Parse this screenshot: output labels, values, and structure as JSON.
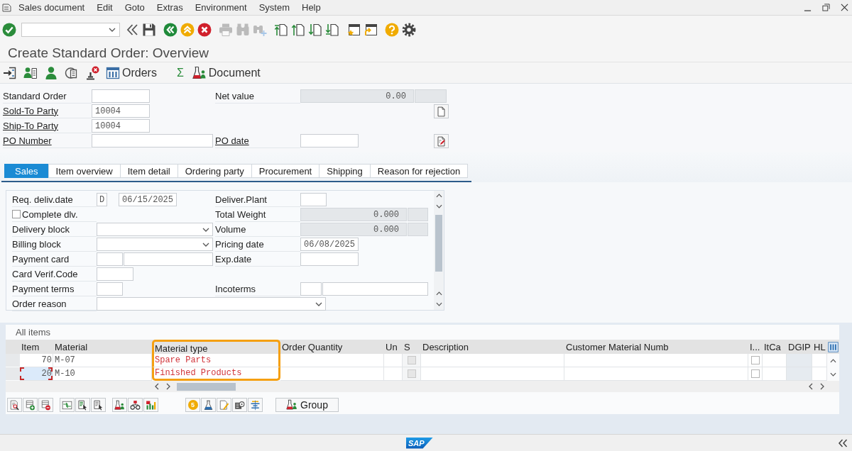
{
  "menu_bar": {
    "items": [
      "Sales document",
      "Edit",
      "Goto",
      "Extras",
      "Environment",
      "System",
      "Help"
    ]
  },
  "toolbar": {
    "groups": [
      [
        {
          "kind": "enter",
          "disabled": false
        },
        {
          "kind": "command-field",
          "disabled": false
        },
        {
          "kind": "collapse",
          "disabled": false
        },
        {
          "kind": "save",
          "disabled": false
        }
      ],
      [
        {
          "kind": "back",
          "disabled": false
        },
        {
          "kind": "exit",
          "disabled": false
        },
        {
          "kind": "cancel",
          "disabled": false
        }
      ],
      [
        {
          "kind": "print",
          "disabled": true
        },
        {
          "kind": "find",
          "disabled": true
        },
        {
          "kind": "find-next",
          "disabled": true
        }
      ],
      [
        {
          "kind": "first-page",
          "disabled": false
        },
        {
          "kind": "previous-page",
          "disabled": false
        },
        {
          "kind": "next-page",
          "disabled": false
        },
        {
          "kind": "last-page",
          "disabled": false
        }
      ],
      [
        {
          "kind": "new-session",
          "disabled": false
        },
        {
          "kind": "shortcut",
          "disabled": false
        }
      ],
      [
        {
          "kind": "help",
          "disabled": false
        },
        {
          "kind": "settings",
          "disabled": false
        }
      ]
    ]
  },
  "title": "Create Standard Order: Overview",
  "app_toolbar": {
    "items": [
      {
        "kind": "arrow-into-page"
      },
      {
        "kind": "person-page"
      },
      {
        "kind": "person"
      },
      {
        "kind": "display"
      },
      {
        "kind": "stamp-delete"
      },
      {
        "kind": "table",
        "label": "Orders"
      },
      {
        "kind": "sum",
        "label": "Σ"
      },
      {
        "kind": "flask",
        "label": "Document"
      }
    ]
  },
  "header": {
    "rows": [
      {
        "left": {
          "label": "Standard Order",
          "link": false,
          "kind": "short"
        },
        "right": {
          "label": "Net value",
          "link": false,
          "kind": "amount",
          "value": "0.00"
        }
      },
      {
        "left": {
          "label": "Sold-To Party",
          "link": true,
          "kind": "short",
          "value": "10004"
        },
        "button": {
          "kind": "page"
        }
      },
      {
        "left": {
          "label": "Ship-To Party",
          "link": true,
          "kind": "short",
          "value": "10004"
        }
      },
      {
        "left": {
          "label": "PO Number",
          "link": true,
          "kind": "long"
        },
        "right": {
          "label": "PO date",
          "link": true,
          "kind": "short"
        },
        "button": {
          "kind": "page-pen"
        }
      }
    ]
  },
  "tabs": [
    {
      "label": "Sales",
      "selected": true
    },
    {
      "label": "Item overview",
      "selected": false
    },
    {
      "label": "Item detail",
      "selected": false
    },
    {
      "label": "Ordering party",
      "selected": false
    },
    {
      "label": "Procurement",
      "selected": false
    },
    {
      "label": "Shipping",
      "selected": false
    },
    {
      "label": "Reason for rejection",
      "selected": false
    }
  ],
  "sales_tab": {
    "rows": [
      {
        "left": {
          "label": "Req. deliv.date",
          "link": false,
          "kind": "code-date",
          "code": "D",
          "value": "06/15/2025"
        },
        "right": {
          "label": "Deliver.Plant",
          "link": false,
          "kind": "tiny"
        }
      },
      {
        "left": {
          "label": "Complete dlv.",
          "link": false,
          "kind": "checkbox",
          "checked": false
        },
        "right": {
          "label": "Total Weight",
          "link": false,
          "kind": "amount",
          "value": "0.000"
        }
      },
      {
        "left": {
          "label": "Delivery block",
          "link": false,
          "kind": "dropdown"
        },
        "right": {
          "label": "Volume",
          "link": false,
          "kind": "amount",
          "value": "0.000"
        }
      },
      {
        "left": {
          "label": "Billing block",
          "link": false,
          "kind": "dropdown"
        },
        "right": {
          "label": "Pricing date",
          "link": false,
          "kind": "short",
          "value": "06/08/2025"
        }
      },
      {
        "left": {
          "label": "Payment card",
          "link": false,
          "kind": "pair"
        },
        "right": {
          "label": "Exp.date",
          "link": false,
          "kind": "short"
        }
      },
      {
        "left": {
          "label": "Card Verif.Code",
          "link": false,
          "kind": "small"
        }
      },
      {
        "left": {
          "label": "Payment terms",
          "link": false,
          "kind": "tiny"
        },
        "right": {
          "label": "Incoterms",
          "link": false,
          "kind": "pair"
        }
      },
      {
        "left": {
          "label": "Order reason",
          "link": false,
          "kind": "wide-dropdown"
        }
      }
    ]
  },
  "items_table": {
    "title": "All items",
    "columns": [
      {
        "label": "Item",
        "highlighted": false
      },
      {
        "label": "Material",
        "highlighted": false
      },
      {
        "label": "Material type",
        "highlighted": true
      },
      {
        "label": "Order Quantity",
        "highlighted": false
      },
      {
        "label": "Un",
        "highlighted": false
      },
      {
        "label": "S",
        "highlighted": false
      },
      {
        "label": "Description",
        "highlighted": false
      },
      {
        "label": "Customer Material Numb",
        "highlighted": false
      },
      {
        "label": "I...",
        "highlighted": false
      },
      {
        "label": "ItCa",
        "highlighted": false
      },
      {
        "label": "DGIP",
        "highlighted": false
      },
      {
        "label": "HL",
        "highlighted": false
      }
    ],
    "rows": [
      {
        "item": "70",
        "material": "M-07",
        "material_type": "Spare Parts",
        "s_checked": false,
        "i_checked": false,
        "focused": false
      },
      {
        "item": "20",
        "material": "M-10",
        "material_type": "Finished Products",
        "s_checked": false,
        "i_checked": false,
        "focused": true
      }
    ]
  },
  "items_toolbar": {
    "groups": [
      [
        {
          "kind": "details"
        },
        {
          "kind": "insert-row"
        },
        {
          "kind": "delete-row"
        }
      ],
      [
        {
          "kind": "move"
        },
        {
          "kind": "select-all"
        },
        {
          "kind": "deselect-all"
        }
      ],
      [
        {
          "kind": "flask"
        },
        {
          "kind": "structure"
        },
        {
          "kind": "chart"
        }
      ],
      [
        {
          "kind": "coin",
          "label": "5"
        },
        {
          "kind": "flask-blue"
        },
        {
          "kind": "edit-page"
        },
        {
          "kind": "machine"
        },
        {
          "kind": "align"
        }
      ]
    ],
    "group_button": {
      "kind": "flask",
      "label": "Group"
    }
  },
  "status_bar": {
    "logo": "SAP"
  }
}
